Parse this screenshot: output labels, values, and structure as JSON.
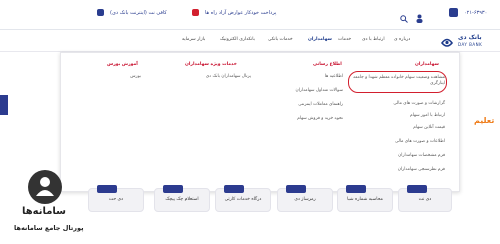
{
  "topbar": {
    "phone": "۰۲۱-۶۳۹۳۰",
    "promo_text": "پرداخت خودکار عوارض آزاد راه ها",
    "digital_bank_text": "کافی نت (اینترنت بانک دی)"
  },
  "brand": {
    "name_fa": "بانک دی",
    "name_en": "DAY BANK",
    "accent_color": "#1d3b8b",
    "highlight_color": "#d21f2e"
  },
  "nav": {
    "items": [
      "درباره ی",
      "ارتباط با دی",
      "خدمات",
      "سهامداران",
      "خدمات بانکی",
      "بانکداری الکترونیک",
      "بازار سرمایه"
    ]
  },
  "menu": {
    "shareholders": {
      "heading": "سهامداران",
      "items": [
        "مشاهده وضعیت سهام خانواده معظم شهدا و جامعه ایثارگری",
        "گزارشات و صورت های مالی",
        "ارتباط با امور سهام",
        "قیمت آنلاین سهام",
        "اطلاعات و صورت های مالی",
        "فرم مشخصات سهامداران",
        "فرم نظرسنجی سهامداران"
      ]
    },
    "notices": {
      "heading": "اطلاع رسانی",
      "items": [
        "اطلاعیه ها",
        "سوالات متداول سهامداران",
        "راهنمای معاملات اینترنتی",
        "نحوه خرید و فروش سهام"
      ]
    },
    "special_services": {
      "heading": "خدمات ویژه سهامداران",
      "items": [
        "پرتال سهامداران بانک دی"
      ]
    },
    "bourse_training": {
      "heading": "آموزش بورس",
      "items": [
        "بورس"
      ]
    }
  },
  "cards": [
    "دی نت",
    "محاسبه شماره شبا",
    "رمزساز دی",
    "درگاه خدمات کارتی",
    "استعلام چک پیچک",
    "دی حت"
  ],
  "watermark": {
    "title": "سامانه‌ها",
    "subtitle": "پورتال جامع سامانه‌ها"
  },
  "side_text": "تعلیم"
}
